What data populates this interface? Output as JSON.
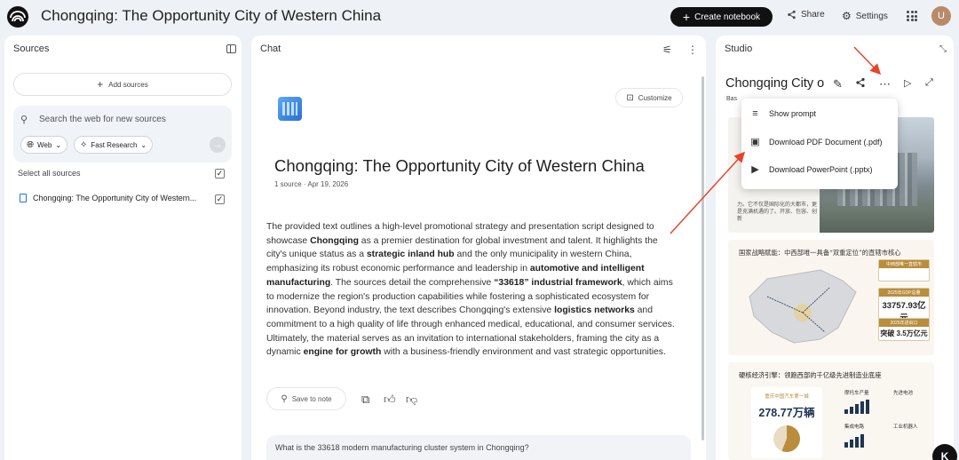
{
  "app": {
    "title": "Chongqing: The Opportunity City of Western China",
    "avatar_letter": "U"
  },
  "header": {
    "create_label": "Create notebook",
    "share_label": "Share",
    "settings_label": "Settings"
  },
  "sources": {
    "title": "Sources",
    "add_label": "Add sources",
    "search_placeholder": "Search the web for new sources",
    "web_chip": "Web",
    "research_chip": "Fast Research",
    "select_all": "Select all sources",
    "items": [
      {
        "label": "Chongqing: The Opportunity City of Western..."
      }
    ]
  },
  "chat": {
    "title": "Chat",
    "customize_label": "Customize",
    "notebook_title": "Chongqing: The Opportunity City of Western China",
    "meta": "1 source · Apr 19, 2026",
    "summary": [
      {
        "t": "The provided text outlines a high-level promotional strategy and presentation script designed to showcase ",
        "b": false
      },
      {
        "t": "Chongqing",
        "b": true
      },
      {
        "t": " as a premier destination for global investment and talent. It highlights the city's unique status as a ",
        "b": false
      },
      {
        "t": "strategic inland hub",
        "b": true
      },
      {
        "t": " and the only municipality in western China, emphasizing its robust economic performance and leadership in ",
        "b": false
      },
      {
        "t": "automotive and intelligent manufacturing",
        "b": true
      },
      {
        "t": ". The sources detail the comprehensive ",
        "b": false
      },
      {
        "t": "“33618” industrial framework",
        "b": true
      },
      {
        "t": ", which aims to modernize the region's production capabilities while fostering a sophisticated ecosystem for innovation. Beyond industry, the text describes Chongqing's extensive ",
        "b": false
      },
      {
        "t": "logistics networks",
        "b": true
      },
      {
        "t": " and commitment to a high quality of life through enhanced medical, educational, and consumer services. Ultimately, the material serves as an invitation to international stakeholders, framing the city as a dynamic ",
        "b": false
      },
      {
        "t": "engine for growth",
        "b": true
      },
      {
        "t": " with a business-friendly environment and vast strategic opportunities.",
        "b": false
      }
    ],
    "save_label": "Save to note",
    "suggestion": "What is the 33618 modern manufacturing cluster system in Chongqing?"
  },
  "studio": {
    "title": "Studio",
    "artifact_title": "Chongqing City o",
    "based_label": "Bas",
    "slide1_caption": "力。它不仅是国际化的大都市，更是充满机遇的了。开放、包容、创新",
    "slide2": {
      "heading": "国家战略赋能：中西部唯一具备“双重定位”的直辖市核心",
      "stats": [
        {
          "tag": "中西部唯一直辖市",
          "value": ""
        },
        {
          "tag": "2025年GDP总量",
          "value": "33757.93亿元"
        },
        {
          "tag": "2025年进出口",
          "value": "突破 3.5万亿元"
        }
      ]
    },
    "slide3": {
      "heading": "硬核经济引擎：领跑西部的千亿级先进制造业底座",
      "card_label": "重庆中国汽车第一城",
      "card_value": "278.77万辆",
      "minis": [
        "摩托车产量",
        "先进电池",
        "集成电路",
        "工业机器人"
      ]
    },
    "menu": [
      {
        "label": "Show prompt",
        "icon": "prompt-icon"
      },
      {
        "label": "Download PDF Document (.pdf)",
        "icon": "pdf-icon"
      },
      {
        "label": "Download PowerPoint (.pptx)",
        "icon": "pptx-icon"
      }
    ]
  },
  "colors": {
    "accent": "#111111",
    "annotation_arrow": "#e8432a",
    "link_blue": "#1a73e8",
    "gold": "#b98d3c"
  }
}
